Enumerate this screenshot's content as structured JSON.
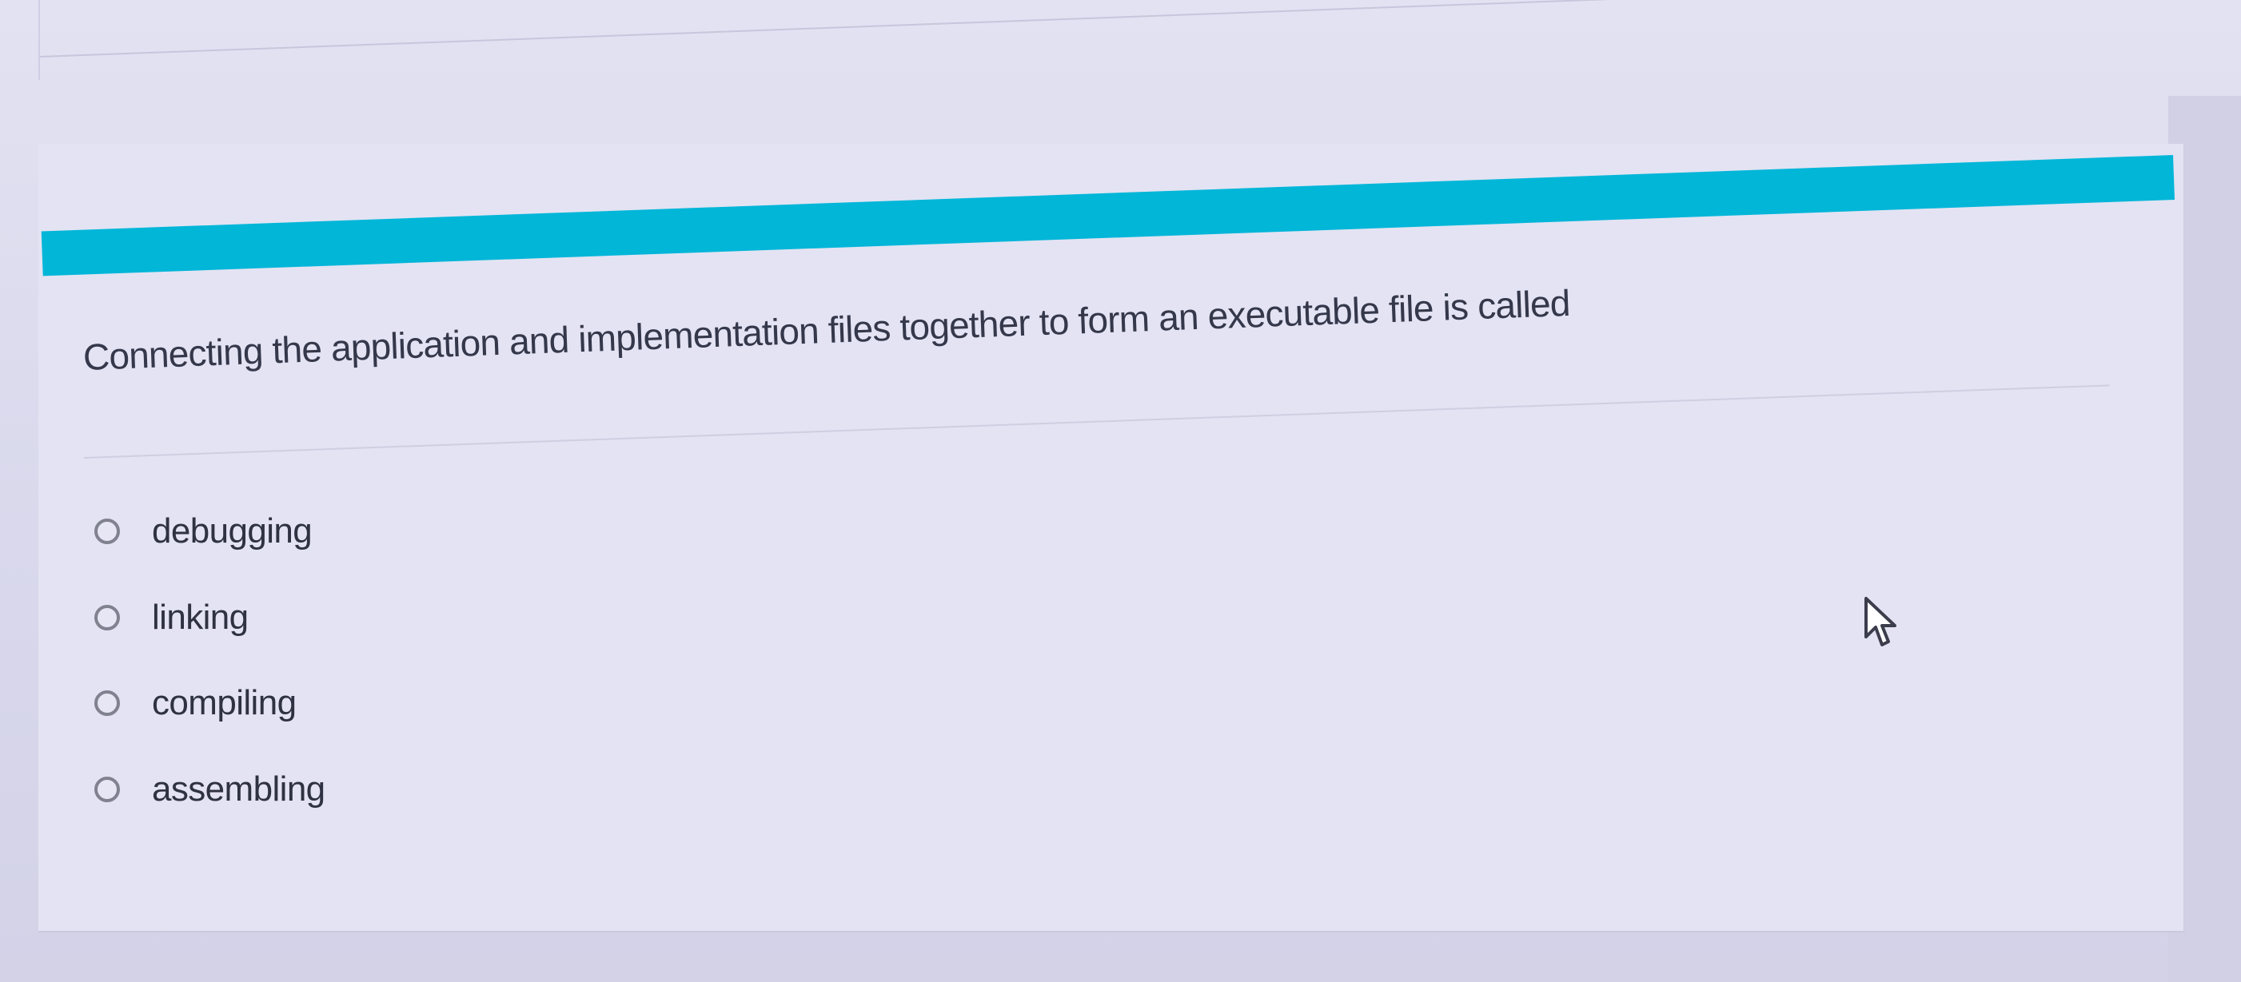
{
  "question": {
    "text": "Connecting the application and implementation files together to form an executable file is called"
  },
  "options": [
    {
      "label": "debugging"
    },
    {
      "label": "linking"
    },
    {
      "label": "compiling"
    },
    {
      "label": "assembling"
    }
  ],
  "colors": {
    "accent": "#02b6d8",
    "background": "#dcdcef",
    "text": "#34384a",
    "radio_border": "#80828f"
  },
  "icons": {
    "cursor": "mouse-pointer-icon",
    "radio": "radio-unchecked-icon"
  }
}
